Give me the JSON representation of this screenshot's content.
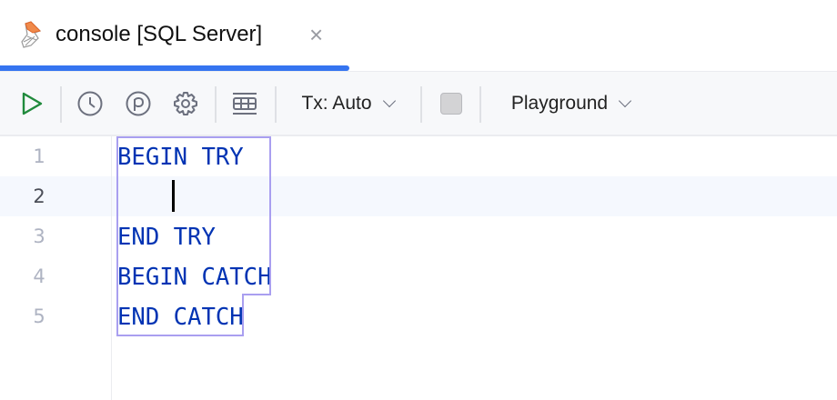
{
  "tab": {
    "title": "console [SQL Server]",
    "close": "×"
  },
  "toolbar": {
    "tx_label": "Tx: Auto",
    "schema_label": "Playground"
  },
  "editor": {
    "lines": [
      {
        "number": "1",
        "text": "BEGIN TRY"
      },
      {
        "number": "2",
        "text": ""
      },
      {
        "number": "3",
        "text": "END TRY"
      },
      {
        "number": "4",
        "text": "BEGIN CATCH"
      },
      {
        "number": "5",
        "text": "END CATCH"
      }
    ],
    "current_line": 2
  },
  "colors": {
    "accent": "#3574f0",
    "keyword": "#0033b3",
    "run": "#208a3c",
    "outline": "#a99ff0"
  }
}
